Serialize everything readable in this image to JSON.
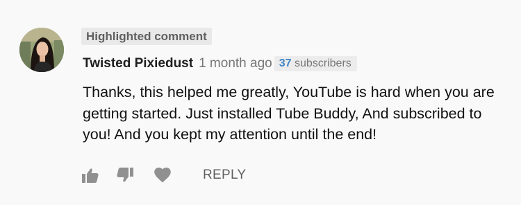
{
  "comment": {
    "highlight_label": "Highlighted comment",
    "author": "Twisted Pixiedust",
    "timestamp": "1 month ago",
    "subscriber_count": "37",
    "subscriber_label": "subscribers",
    "text": "Thanks, this helped me greatly, YouTube is hard when you are getting started. Just installed Tube Buddy, And subscribed to you! And you kept my attention until the end!"
  },
  "actions": {
    "like_icon": "thumbs-up-icon",
    "dislike_icon": "thumbs-down-icon",
    "heart_icon": "heart-icon",
    "reply_label": "REPLY"
  },
  "colors": {
    "background": "#f9f9f9",
    "badge_background": "#e9e9e9",
    "subscriber_count": "#3f86c6",
    "icon": "#909090"
  }
}
